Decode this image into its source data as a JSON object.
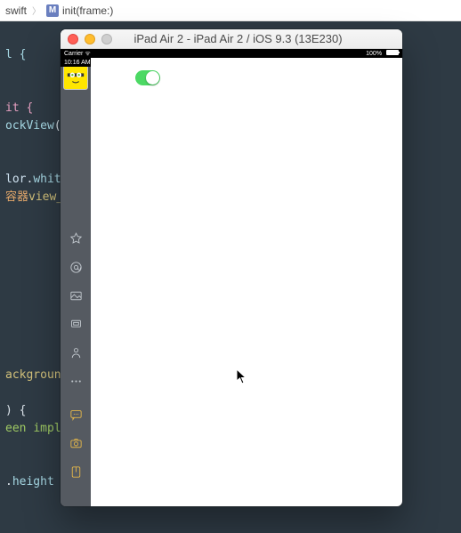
{
  "breadcrumb": {
    "file": "swift",
    "method_icon": "M",
    "method": "init(frame:)"
  },
  "editor": {
    "l1": "l {",
    "l2": "",
    "l3": "",
    "l4": "it {",
    "l5a": "ockView",
    "l5b": "(",
    "l6": "",
    "l7": "",
    "l8a": "lor",
    "l8b": ".",
    "l8c": "whit",
    "l9a": "容器",
    "l9b": "view_h",
    "l10": "",
    "l11": "",
    "l12": "",
    "l13": "",
    "l14a": "ackground",
    "l15": "",
    "l16a": ") {",
    "l17a": "een ",
    "l17b": "impl",
    "l18": "",
    "l19": "",
    "l20a": ".",
    "l20b": "height"
  },
  "simulator": {
    "title": "iPad Air 2 - iPad Air 2 / iOS 9.3 (13E230)",
    "statusbar": {
      "carrier": "Carrier",
      "wifi_icon": "wifi",
      "time": "10:16 AM",
      "battery_pct": "100%"
    },
    "sidebar_icons": [
      {
        "id": "star",
        "label": "star-icon"
      },
      {
        "id": "at",
        "label": "at-icon"
      },
      {
        "id": "image",
        "label": "image-icon"
      },
      {
        "id": "screen",
        "label": "screen-icon"
      },
      {
        "id": "person",
        "label": "person-icon"
      },
      {
        "id": "dots",
        "label": "dots-icon"
      },
      {
        "id": "chat",
        "label": "chat-icon"
      },
      {
        "id": "camera",
        "label": "camera-icon"
      },
      {
        "id": "note",
        "label": "note-icon"
      }
    ],
    "switch_state": "on"
  }
}
